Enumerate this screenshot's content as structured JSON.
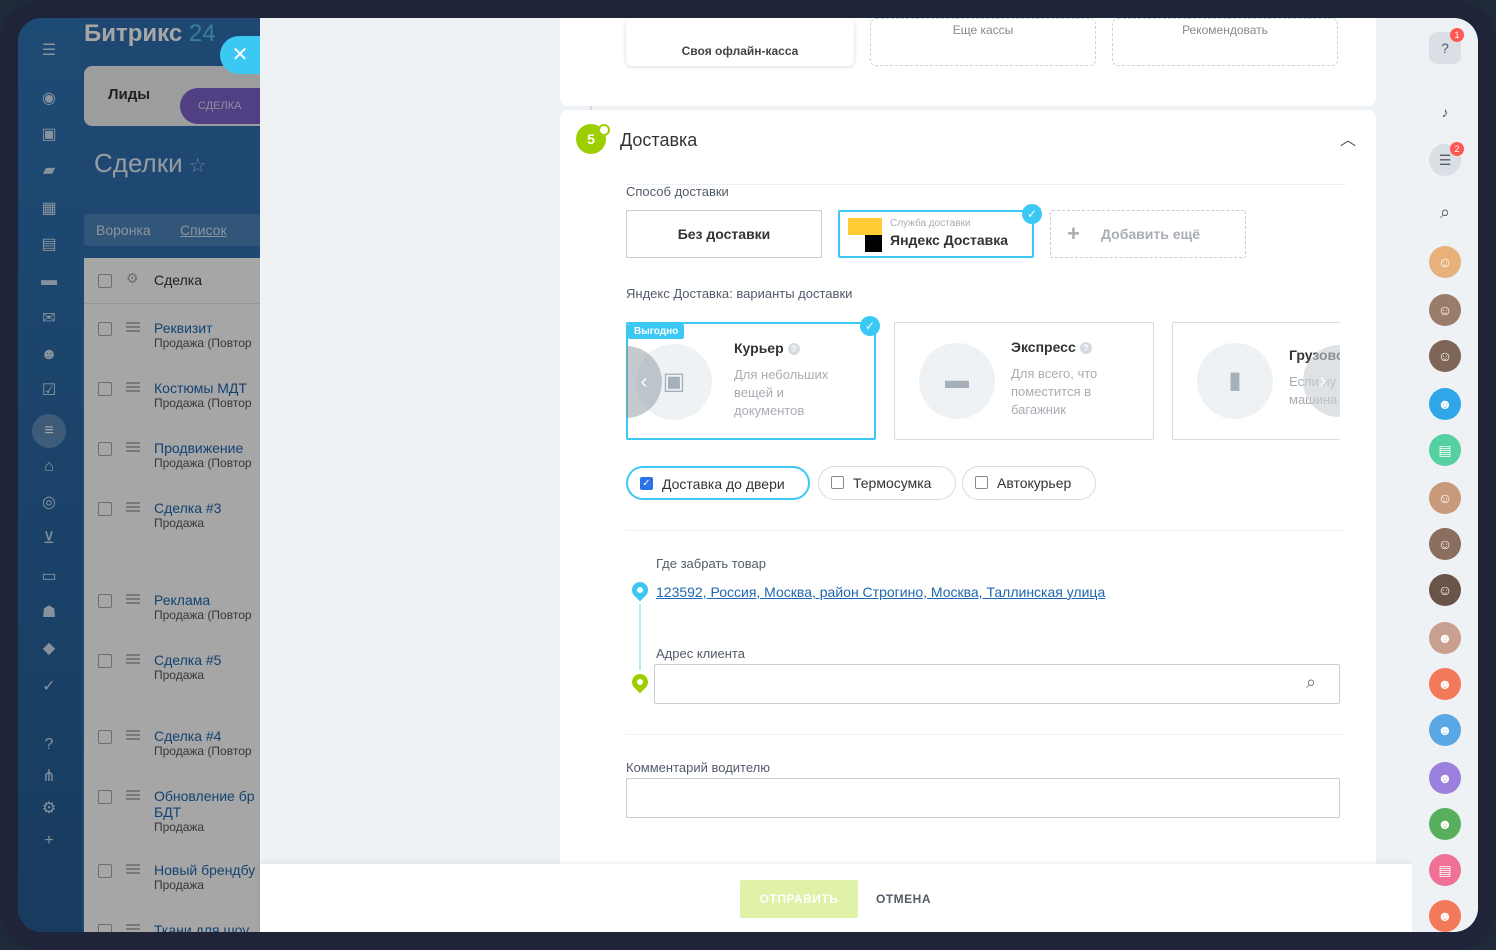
{
  "app": {
    "logo_main": "Битрикс",
    "logo_num": "24"
  },
  "crm": {
    "tab_leads": "Лиды",
    "tab_deal": "СДЕЛКА",
    "title": "Сделки",
    "subtab_funnel": "Воронка",
    "subtab_list": "Список",
    "header_col": "Сделка",
    "rows": [
      {
        "title": "Реквизит",
        "sub": "Продажа (Повтор"
      },
      {
        "title": "Костюмы МДТ",
        "sub": "Продажа (Повтор"
      },
      {
        "title": "Продвижение",
        "sub": "Продажа (Повтор"
      },
      {
        "title": "Сделка #3",
        "sub": "Продажа"
      },
      {
        "title": "Реклама",
        "sub": "Продажа (Повтор"
      },
      {
        "title": "Сделка #5",
        "sub": "Продажа"
      },
      {
        "title": "Сделка #4",
        "sub": "Продажа (Повтор"
      },
      {
        "title": "Обновление бр",
        "title2": "БДТ",
        "sub": "Продажа"
      },
      {
        "title": "Новый брендбу",
        "sub": "Продажа"
      },
      {
        "title": "Ткани для шоу",
        "sub": ""
      }
    ]
  },
  "top_tiles": {
    "offline": "Своя офлайн-касса",
    "more": "Еще кассы",
    "recommend": "Рекомендовать"
  },
  "delivery": {
    "step": "5",
    "title": "Доставка",
    "method_label": "Способ доставки",
    "no_delivery": "Без доставки",
    "service_caption": "Служба доставки",
    "service_name": "Яндекс Доставка",
    "add_more": "Добавить ещё",
    "variants_label": "Яндекс Доставка: варианты доставки",
    "options": [
      {
        "name": "Курьер",
        "desc": [
          "Для небольших",
          "вещей и",
          "документов"
        ],
        "ribbon": "Выгодно"
      },
      {
        "name": "Экспресс",
        "desc": [
          "Для всего, что",
          "поместится в",
          "багажник"
        ]
      },
      {
        "name": "Грузовой",
        "desc": [
          "Если ну",
          "машина"
        ]
      }
    ],
    "extras": [
      {
        "label": "Доставка до двери",
        "checked": true
      },
      {
        "label": "Термосумка",
        "checked": false
      },
      {
        "label": "Автокурьер",
        "checked": false
      }
    ],
    "pickup_label": "Где забрать товар",
    "pickup_address": "123592, Россия, Москва, район Строгино, Москва, Таллинская улица",
    "client_label": "Адрес клиента",
    "client_value": "",
    "comment_label": "Комментарий водителю",
    "comment_value": ""
  },
  "footer": {
    "send": "ОТПРАВИТЬ",
    "cancel": "ОТМЕНА"
  },
  "badges": {
    "help": "1",
    "chat": "2"
  },
  "colors": {
    "accent": "#3bc8f5",
    "green": "#9dcf00",
    "link": "#2067b0"
  }
}
